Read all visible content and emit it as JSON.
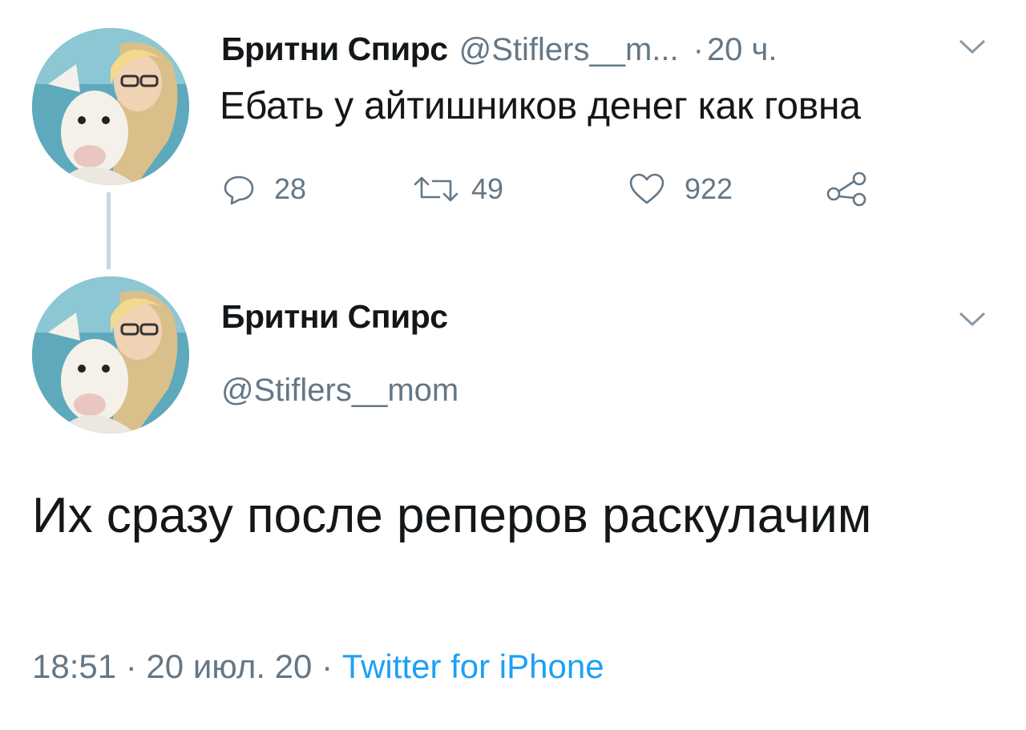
{
  "tweet_reply_parent": {
    "author_name": "Бритни Спирс",
    "handle": "@Stiflers__m...",
    "separator": "·",
    "time": "20 ч.",
    "text": "Ебать у айтишников денег как говна",
    "actions": {
      "replies": "28",
      "retweets": "49",
      "likes": "922"
    },
    "icons": [
      "reply-icon",
      "retweet-icon",
      "like-icon",
      "share-icon",
      "chevron-down-icon"
    ]
  },
  "tweet_main": {
    "author_name": "Бритни Спирс",
    "handle": "@Stiflers__mom",
    "text": "Их сразу после реперов раскулачим",
    "timestamp": "18:51 · 20 июл. 20 · ",
    "source": "Twitter for iPhone"
  },
  "colors": {
    "text": "#14171a",
    "muted": "#657786",
    "link": "#1da1f2",
    "thread_line": "#ccd6dd"
  }
}
